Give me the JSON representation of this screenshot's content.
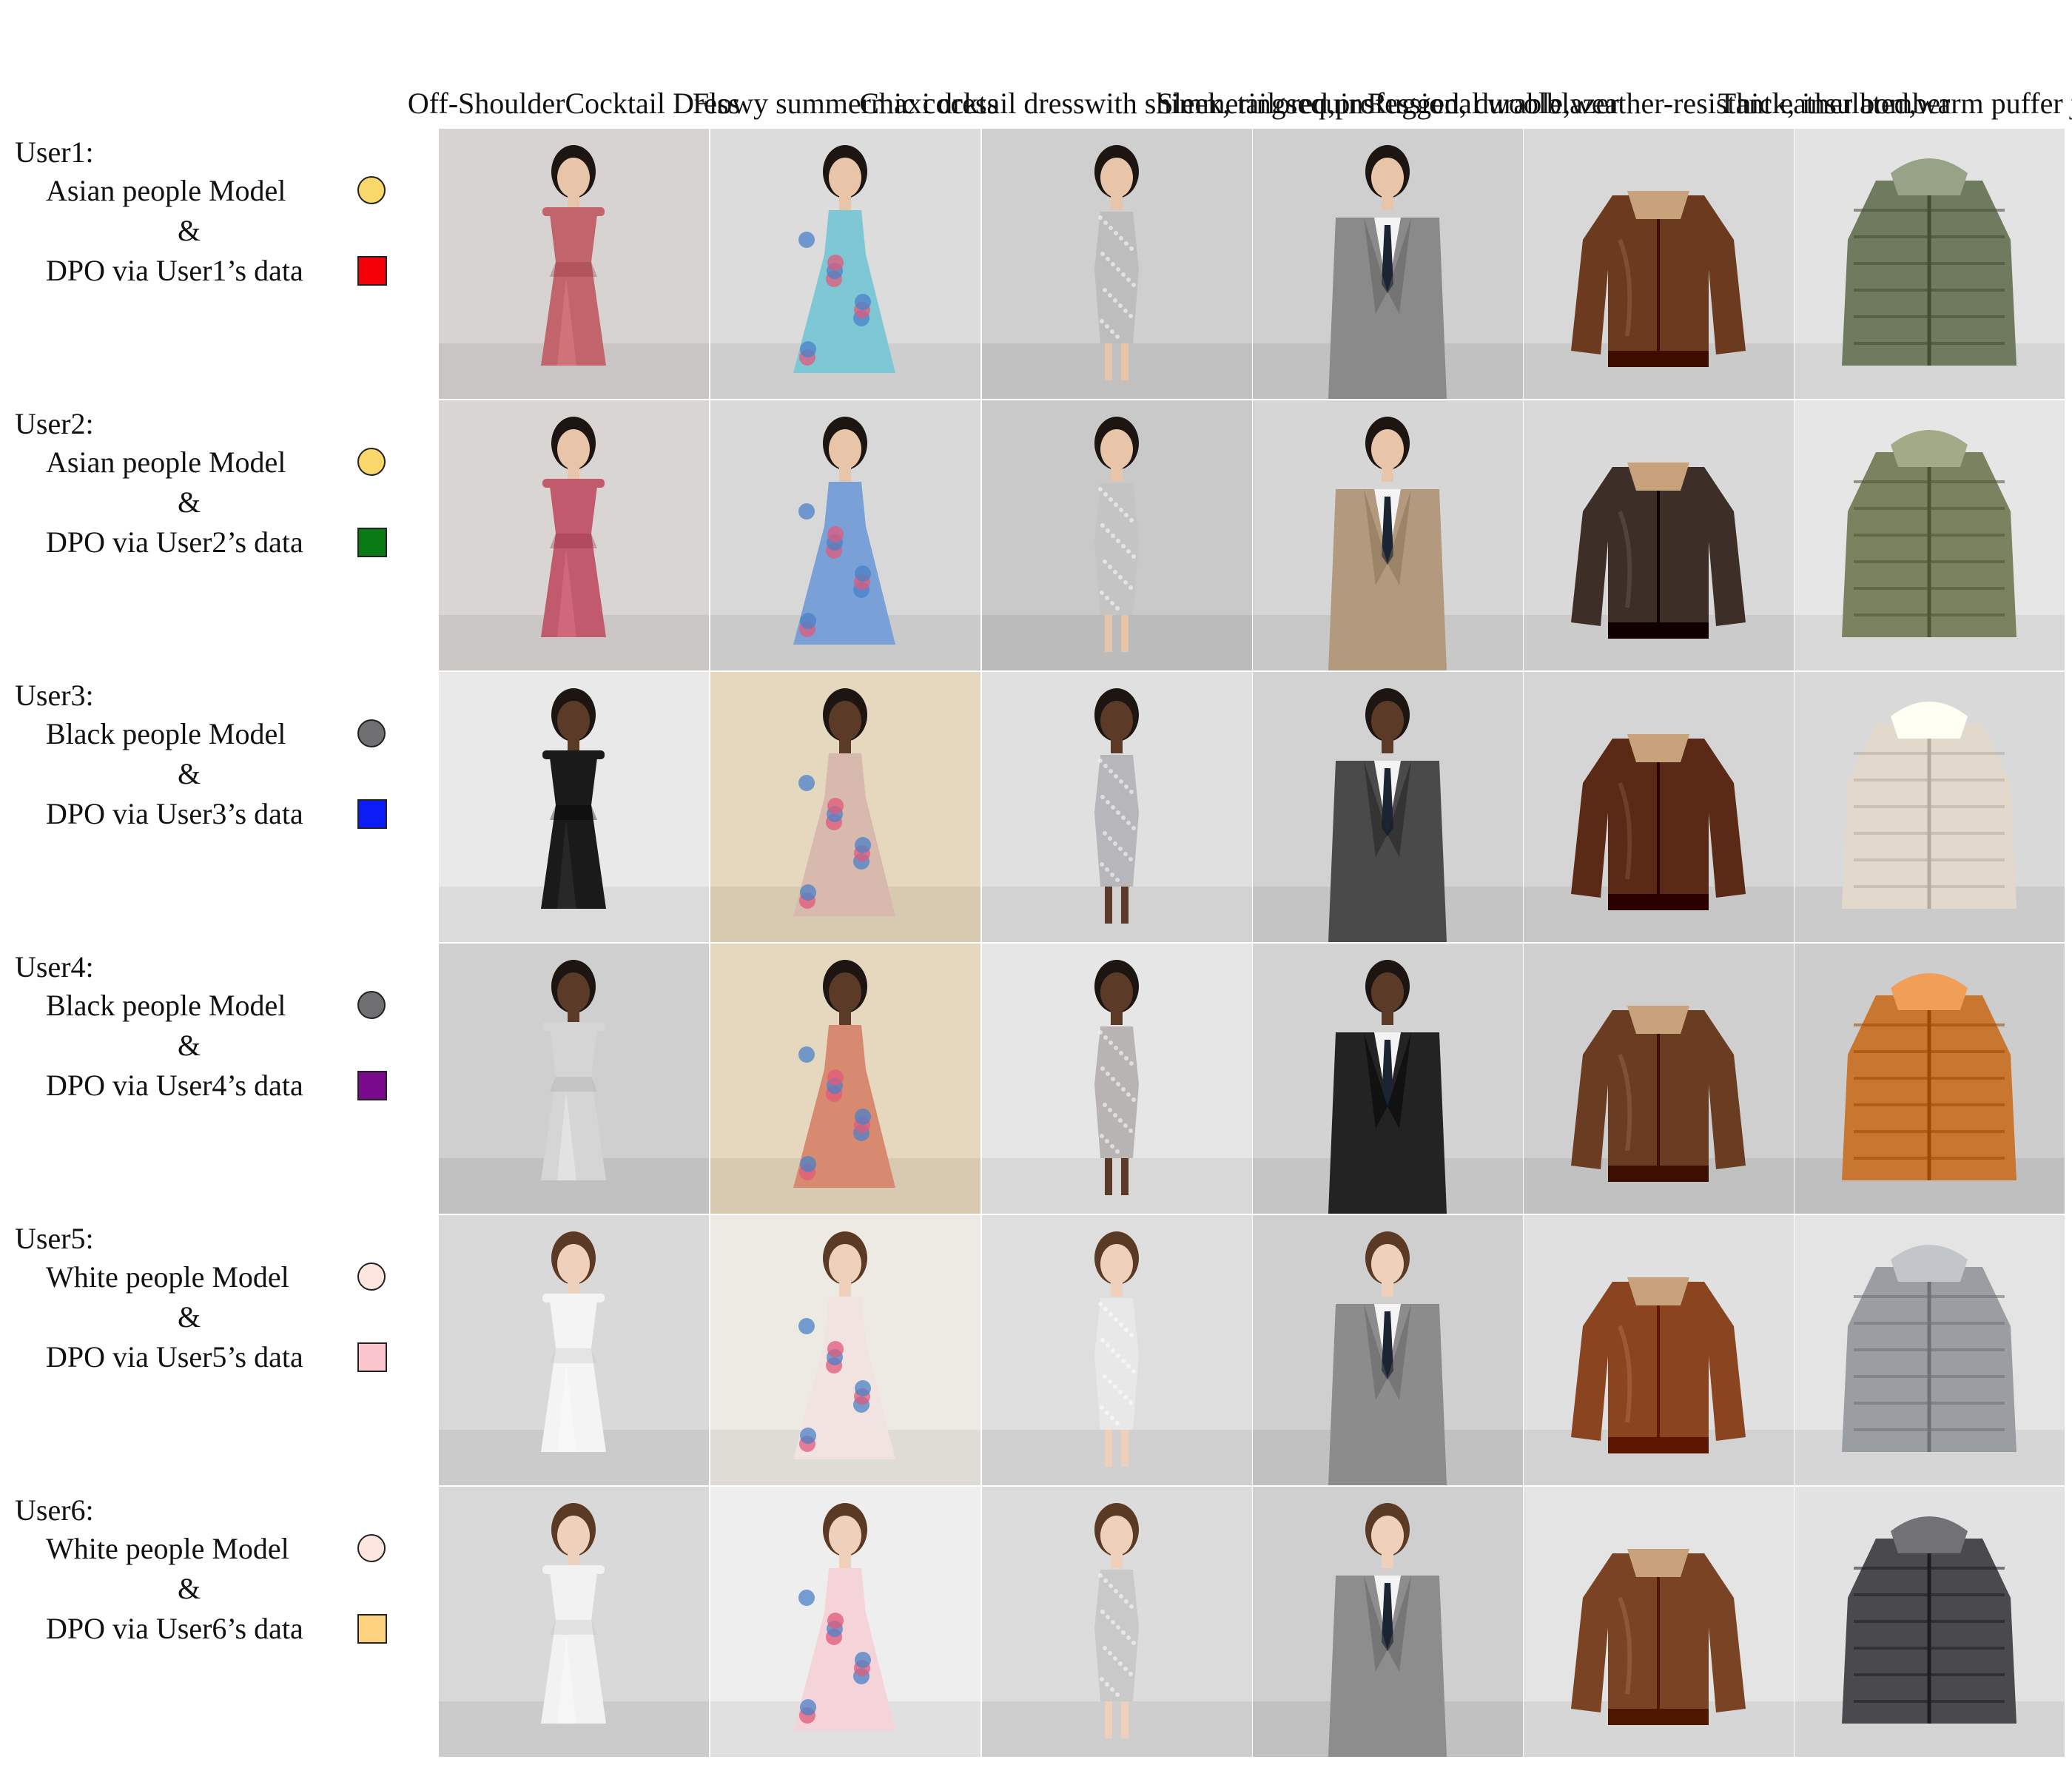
{
  "columns": [
    [
      "Off-Shoulder",
      "Cocktail Dress"
    ],
    [
      "Flowy summer",
      "maxi dress"
    ],
    [
      "Chic cocktail dress",
      "with shimmering",
      "sequins"
    ],
    [
      "Sleek, tailored,",
      "professional wool",
      "blazer"
    ],
    [
      "Rugged, durable,",
      "weather-resistant",
      "leather bomber"
    ],
    [
      "Thick, insulated,",
      "warm puffer jacket"
    ]
  ],
  "rows": [
    {
      "user": "User1:",
      "model": "Asian people Model",
      "amp": "&",
      "dpo": "DPO via User1’s data",
      "circle_color": "#f9d76b",
      "square_color": "#f40009"
    },
    {
      "user": "User2:",
      "model": "Asian people Model",
      "amp": "&",
      "dpo": "DPO via User2’s data",
      "circle_color": "#f9d76b",
      "square_color": "#0a7a14"
    },
    {
      "user": "User3:",
      "model": "Black people Model",
      "amp": "&",
      "dpo": "DPO via User3’s data",
      "circle_color": "#6f6f72",
      "square_color": "#0b1cf6"
    },
    {
      "user": "User4:",
      "model": "Black people Model",
      "amp": "&",
      "dpo": "DPO via User4’s data",
      "circle_color": "#6f6f72",
      "square_color": "#7a0a8c"
    },
    {
      "user": "User5:",
      "model": "White people Model",
      "amp": "&",
      "dpo": "DPO via User5’s data",
      "circle_color": "#fde6e0",
      "square_color": "#fac5cd"
    },
    {
      "user": "User6:",
      "model": "White people Model",
      "amp": "&",
      "dpo": "DPO via User6’s data",
      "circle_color": "#fde6e0",
      "square_color": "#fcd27e"
    }
  ],
  "images": {
    "skin_tones": [
      "#e8c4a8",
      "#e8c4a8",
      "#5b3a28",
      "#5b3a28",
      "#eed0bb",
      "#eed0bb"
    ],
    "backgrounds": [
      [
        "#d7d3d2",
        "#dcdcdc",
        "#cfcfcf",
        "#cfcfcf",
        "#d8d8d8",
        "#e3e3e3"
      ],
      [
        "#d9d5d3",
        "#d8d8d8",
        "#c9c9c9",
        "#d6d6d6",
        "#d9d9d9",
        "#e6e6e6"
      ],
      [
        "#e9e9e9",
        "#e6d8bf",
        "#e0e0e0",
        "#d2d2d2",
        "#d5d5d5",
        "#d9d9d9"
      ],
      [
        "#cfcfcf",
        "#e6d8bf",
        "#e6e6e6",
        "#d3d3d3",
        "#cfcfcf",
        "#cdcdcd"
      ],
      [
        "#d9d9d9",
        "#eceae2",
        "#dedede",
        "#cfcfcf",
        "#e0e0e0",
        "#e4e4e4"
      ],
      [
        "#d9d9d9",
        "#eeeeee",
        "#dcdcdc",
        "#cfcfcf",
        "#e4e4e4",
        "#e2e2e2"
      ]
    ],
    "garment_colors": [
      [
        "#c2646b",
        "#7ec8d6",
        "#bdbdbd",
        "#8a8a8a",
        "#6b3a1f",
        "#6f7a5e"
      ],
      [
        "#c25a6e",
        "#7aa0d8",
        "#c4c4c4",
        "#b39a7e",
        "#3d2e28",
        "#7a8260"
      ],
      [
        "#1a1a1a",
        "#d8b9ae",
        "#b7b7bb",
        "#4a4a4a",
        "#5a2a16",
        "#e2d8cc"
      ],
      [
        "#d5d5d5",
        "#d88a70",
        "#b9b4b4",
        "#232323",
        "#6a3c22",
        "#c87630"
      ],
      [
        "#f4f4f4",
        "#f1e3e0",
        "#e8e8e8",
        "#8c8c8c",
        "#8a4420",
        "#9a9da2"
      ],
      [
        "#f2f2f2",
        "#f4d4d8",
        "#c9c9c9",
        "#8d8d8d",
        "#7a4424",
        "#4a4a4e"
      ]
    ],
    "scene_types": [
      "dress",
      "maxi",
      "sequin",
      "blazer",
      "bomber",
      "puffer"
    ]
  }
}
